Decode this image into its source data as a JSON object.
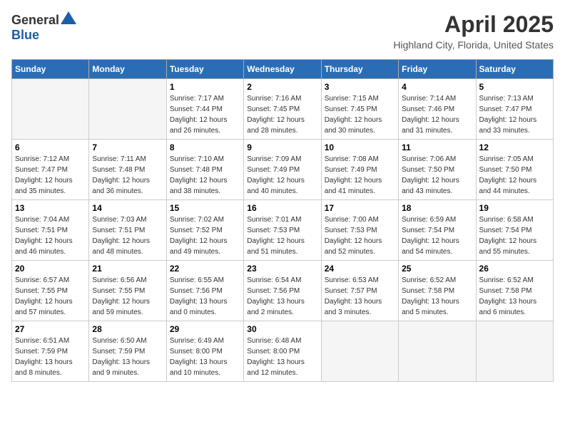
{
  "header": {
    "logo_general": "General",
    "logo_blue": "Blue",
    "title": "April 2025",
    "subtitle": "Highland City, Florida, United States"
  },
  "days_of_week": [
    "Sunday",
    "Monday",
    "Tuesday",
    "Wednesday",
    "Thursday",
    "Friday",
    "Saturday"
  ],
  "weeks": [
    [
      {
        "day": "",
        "empty": true
      },
      {
        "day": "",
        "empty": true
      },
      {
        "day": "1",
        "sunrise": "7:17 AM",
        "sunset": "7:44 PM",
        "daylight": "12 hours and 26 minutes."
      },
      {
        "day": "2",
        "sunrise": "7:16 AM",
        "sunset": "7:45 PM",
        "daylight": "12 hours and 28 minutes."
      },
      {
        "day": "3",
        "sunrise": "7:15 AM",
        "sunset": "7:45 PM",
        "daylight": "12 hours and 30 minutes."
      },
      {
        "day": "4",
        "sunrise": "7:14 AM",
        "sunset": "7:46 PM",
        "daylight": "12 hours and 31 minutes."
      },
      {
        "day": "5",
        "sunrise": "7:13 AM",
        "sunset": "7:47 PM",
        "daylight": "12 hours and 33 minutes."
      }
    ],
    [
      {
        "day": "6",
        "sunrise": "7:12 AM",
        "sunset": "7:47 PM",
        "daylight": "12 hours and 35 minutes."
      },
      {
        "day": "7",
        "sunrise": "7:11 AM",
        "sunset": "7:48 PM",
        "daylight": "12 hours and 36 minutes."
      },
      {
        "day": "8",
        "sunrise": "7:10 AM",
        "sunset": "7:48 PM",
        "daylight": "12 hours and 38 minutes."
      },
      {
        "day": "9",
        "sunrise": "7:09 AM",
        "sunset": "7:49 PM",
        "daylight": "12 hours and 40 minutes."
      },
      {
        "day": "10",
        "sunrise": "7:08 AM",
        "sunset": "7:49 PM",
        "daylight": "12 hours and 41 minutes."
      },
      {
        "day": "11",
        "sunrise": "7:06 AM",
        "sunset": "7:50 PM",
        "daylight": "12 hours and 43 minutes."
      },
      {
        "day": "12",
        "sunrise": "7:05 AM",
        "sunset": "7:50 PM",
        "daylight": "12 hours and 44 minutes."
      }
    ],
    [
      {
        "day": "13",
        "sunrise": "7:04 AM",
        "sunset": "7:51 PM",
        "daylight": "12 hours and 46 minutes."
      },
      {
        "day": "14",
        "sunrise": "7:03 AM",
        "sunset": "7:51 PM",
        "daylight": "12 hours and 48 minutes."
      },
      {
        "day": "15",
        "sunrise": "7:02 AM",
        "sunset": "7:52 PM",
        "daylight": "12 hours and 49 minutes."
      },
      {
        "day": "16",
        "sunrise": "7:01 AM",
        "sunset": "7:53 PM",
        "daylight": "12 hours and 51 minutes."
      },
      {
        "day": "17",
        "sunrise": "7:00 AM",
        "sunset": "7:53 PM",
        "daylight": "12 hours and 52 minutes."
      },
      {
        "day": "18",
        "sunrise": "6:59 AM",
        "sunset": "7:54 PM",
        "daylight": "12 hours and 54 minutes."
      },
      {
        "day": "19",
        "sunrise": "6:58 AM",
        "sunset": "7:54 PM",
        "daylight": "12 hours and 55 minutes."
      }
    ],
    [
      {
        "day": "20",
        "sunrise": "6:57 AM",
        "sunset": "7:55 PM",
        "daylight": "12 hours and 57 minutes."
      },
      {
        "day": "21",
        "sunrise": "6:56 AM",
        "sunset": "7:55 PM",
        "daylight": "12 hours and 59 minutes."
      },
      {
        "day": "22",
        "sunrise": "6:55 AM",
        "sunset": "7:56 PM",
        "daylight": "13 hours and 0 minutes."
      },
      {
        "day": "23",
        "sunrise": "6:54 AM",
        "sunset": "7:56 PM",
        "daylight": "13 hours and 2 minutes."
      },
      {
        "day": "24",
        "sunrise": "6:53 AM",
        "sunset": "7:57 PM",
        "daylight": "13 hours and 3 minutes."
      },
      {
        "day": "25",
        "sunrise": "6:52 AM",
        "sunset": "7:58 PM",
        "daylight": "13 hours and 5 minutes."
      },
      {
        "day": "26",
        "sunrise": "6:52 AM",
        "sunset": "7:58 PM",
        "daylight": "13 hours and 6 minutes."
      }
    ],
    [
      {
        "day": "27",
        "sunrise": "6:51 AM",
        "sunset": "7:59 PM",
        "daylight": "13 hours and 8 minutes."
      },
      {
        "day": "28",
        "sunrise": "6:50 AM",
        "sunset": "7:59 PM",
        "daylight": "13 hours and 9 minutes."
      },
      {
        "day": "29",
        "sunrise": "6:49 AM",
        "sunset": "8:00 PM",
        "daylight": "13 hours and 10 minutes."
      },
      {
        "day": "30",
        "sunrise": "6:48 AM",
        "sunset": "8:00 PM",
        "daylight": "13 hours and 12 minutes."
      },
      {
        "day": "",
        "empty": true
      },
      {
        "day": "",
        "empty": true
      },
      {
        "day": "",
        "empty": true
      }
    ]
  ],
  "labels": {
    "sunrise": "Sunrise:",
    "sunset": "Sunset:",
    "daylight": "Daylight:"
  }
}
